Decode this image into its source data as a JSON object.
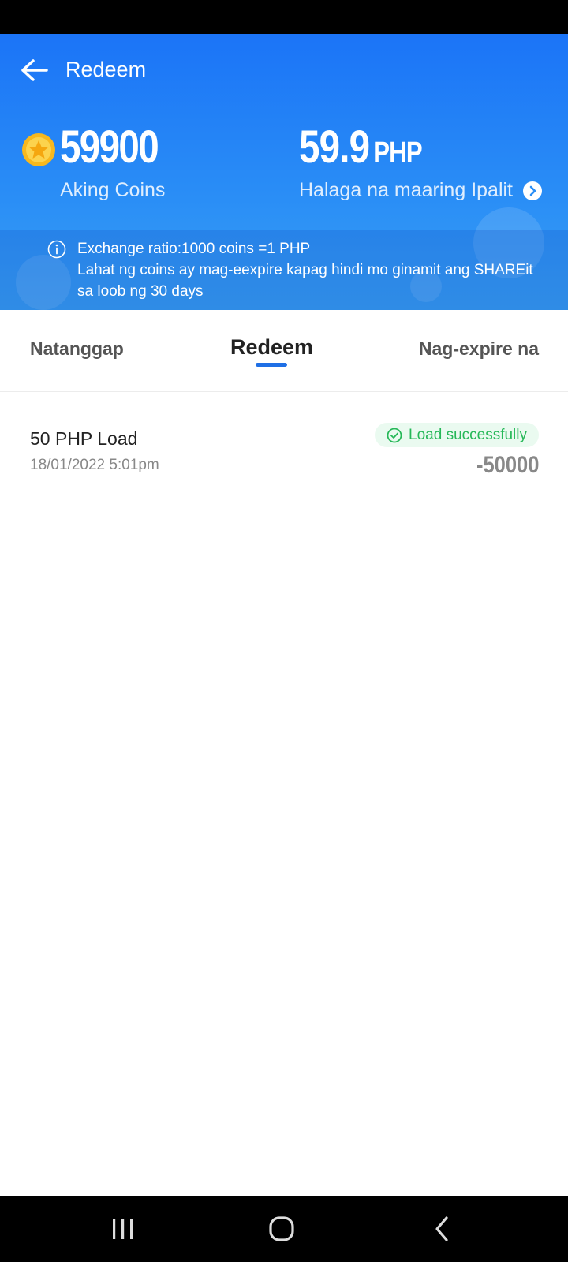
{
  "header": {
    "title": "Redeem",
    "coins_value": "59900",
    "coins_label": "Aking Coins",
    "php_value": "59.9",
    "php_unit": "PHP",
    "php_label": "Halaga na maaring Ipalit"
  },
  "info": {
    "line1": "Exchange ratio:1000 coins =1 PHP",
    "line2": "Lahat ng coins ay mag-eexpire kapag hindi mo ginamit ang SHAREit sa loob ng 30 days"
  },
  "tabs": [
    {
      "label": "Natanggap",
      "active": false
    },
    {
      "label": "Redeem",
      "active": true
    },
    {
      "label": "Nag-expire na",
      "active": false
    }
  ],
  "records": [
    {
      "title": "50 PHP Load",
      "date": "18/01/2022 5:01pm",
      "status": "Load successfully",
      "amount": "-50000"
    }
  ],
  "colors": {
    "header_top": "#1b74f7",
    "accent": "#1f6fe5",
    "success": "#26b858"
  },
  "icons": [
    "back-arrow-icon",
    "coin-icon",
    "chevron-right-circle-icon",
    "info-icon",
    "check-circle-icon",
    "recents-icon",
    "home-icon",
    "back-nav-icon"
  ]
}
